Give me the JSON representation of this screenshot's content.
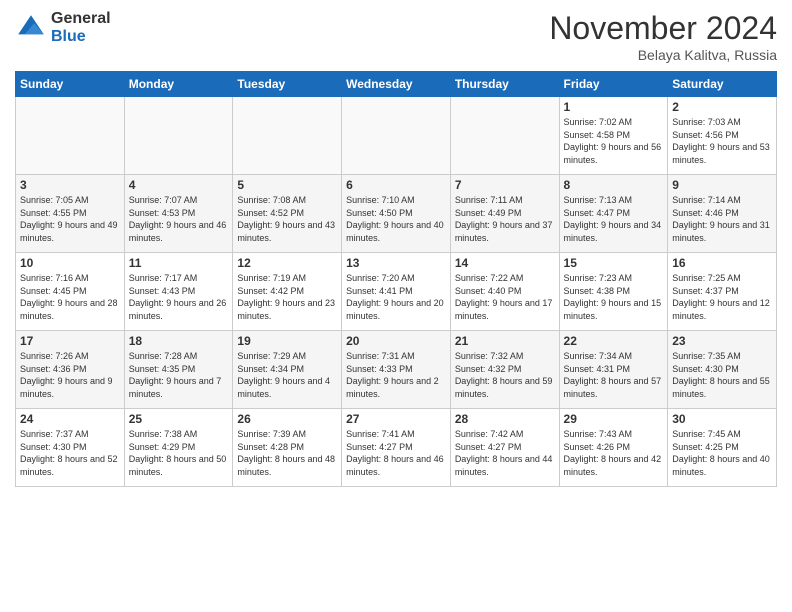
{
  "header": {
    "logo_general": "General",
    "logo_blue": "Blue",
    "title": "November 2024",
    "location": "Belaya Kalitva, Russia"
  },
  "weekdays": [
    "Sunday",
    "Monday",
    "Tuesday",
    "Wednesday",
    "Thursday",
    "Friday",
    "Saturday"
  ],
  "weeks": [
    [
      {
        "day": "",
        "info": ""
      },
      {
        "day": "",
        "info": ""
      },
      {
        "day": "",
        "info": ""
      },
      {
        "day": "",
        "info": ""
      },
      {
        "day": "",
        "info": ""
      },
      {
        "day": "1",
        "info": "Sunrise: 7:02 AM\nSunset: 4:58 PM\nDaylight: 9 hours and 56 minutes."
      },
      {
        "day": "2",
        "info": "Sunrise: 7:03 AM\nSunset: 4:56 PM\nDaylight: 9 hours and 53 minutes."
      }
    ],
    [
      {
        "day": "3",
        "info": "Sunrise: 7:05 AM\nSunset: 4:55 PM\nDaylight: 9 hours and 49 minutes."
      },
      {
        "day": "4",
        "info": "Sunrise: 7:07 AM\nSunset: 4:53 PM\nDaylight: 9 hours and 46 minutes."
      },
      {
        "day": "5",
        "info": "Sunrise: 7:08 AM\nSunset: 4:52 PM\nDaylight: 9 hours and 43 minutes."
      },
      {
        "day": "6",
        "info": "Sunrise: 7:10 AM\nSunset: 4:50 PM\nDaylight: 9 hours and 40 minutes."
      },
      {
        "day": "7",
        "info": "Sunrise: 7:11 AM\nSunset: 4:49 PM\nDaylight: 9 hours and 37 minutes."
      },
      {
        "day": "8",
        "info": "Sunrise: 7:13 AM\nSunset: 4:47 PM\nDaylight: 9 hours and 34 minutes."
      },
      {
        "day": "9",
        "info": "Sunrise: 7:14 AM\nSunset: 4:46 PM\nDaylight: 9 hours and 31 minutes."
      }
    ],
    [
      {
        "day": "10",
        "info": "Sunrise: 7:16 AM\nSunset: 4:45 PM\nDaylight: 9 hours and 28 minutes."
      },
      {
        "day": "11",
        "info": "Sunrise: 7:17 AM\nSunset: 4:43 PM\nDaylight: 9 hours and 26 minutes."
      },
      {
        "day": "12",
        "info": "Sunrise: 7:19 AM\nSunset: 4:42 PM\nDaylight: 9 hours and 23 minutes."
      },
      {
        "day": "13",
        "info": "Sunrise: 7:20 AM\nSunset: 4:41 PM\nDaylight: 9 hours and 20 minutes."
      },
      {
        "day": "14",
        "info": "Sunrise: 7:22 AM\nSunset: 4:40 PM\nDaylight: 9 hours and 17 minutes."
      },
      {
        "day": "15",
        "info": "Sunrise: 7:23 AM\nSunset: 4:38 PM\nDaylight: 9 hours and 15 minutes."
      },
      {
        "day": "16",
        "info": "Sunrise: 7:25 AM\nSunset: 4:37 PM\nDaylight: 9 hours and 12 minutes."
      }
    ],
    [
      {
        "day": "17",
        "info": "Sunrise: 7:26 AM\nSunset: 4:36 PM\nDaylight: 9 hours and 9 minutes."
      },
      {
        "day": "18",
        "info": "Sunrise: 7:28 AM\nSunset: 4:35 PM\nDaylight: 9 hours and 7 minutes."
      },
      {
        "day": "19",
        "info": "Sunrise: 7:29 AM\nSunset: 4:34 PM\nDaylight: 9 hours and 4 minutes."
      },
      {
        "day": "20",
        "info": "Sunrise: 7:31 AM\nSunset: 4:33 PM\nDaylight: 9 hours and 2 minutes."
      },
      {
        "day": "21",
        "info": "Sunrise: 7:32 AM\nSunset: 4:32 PM\nDaylight: 8 hours and 59 minutes."
      },
      {
        "day": "22",
        "info": "Sunrise: 7:34 AM\nSunset: 4:31 PM\nDaylight: 8 hours and 57 minutes."
      },
      {
        "day": "23",
        "info": "Sunrise: 7:35 AM\nSunset: 4:30 PM\nDaylight: 8 hours and 55 minutes."
      }
    ],
    [
      {
        "day": "24",
        "info": "Sunrise: 7:37 AM\nSunset: 4:30 PM\nDaylight: 8 hours and 52 minutes."
      },
      {
        "day": "25",
        "info": "Sunrise: 7:38 AM\nSunset: 4:29 PM\nDaylight: 8 hours and 50 minutes."
      },
      {
        "day": "26",
        "info": "Sunrise: 7:39 AM\nSunset: 4:28 PM\nDaylight: 8 hours and 48 minutes."
      },
      {
        "day": "27",
        "info": "Sunrise: 7:41 AM\nSunset: 4:27 PM\nDaylight: 8 hours and 46 minutes."
      },
      {
        "day": "28",
        "info": "Sunrise: 7:42 AM\nSunset: 4:27 PM\nDaylight: 8 hours and 44 minutes."
      },
      {
        "day": "29",
        "info": "Sunrise: 7:43 AM\nSunset: 4:26 PM\nDaylight: 8 hours and 42 minutes."
      },
      {
        "day": "30",
        "info": "Sunrise: 7:45 AM\nSunset: 4:25 PM\nDaylight: 8 hours and 40 minutes."
      }
    ]
  ],
  "colors": {
    "header_bg": "#1a6bba",
    "row_even": "#f5f5f5",
    "row_odd": "#ffffff"
  }
}
